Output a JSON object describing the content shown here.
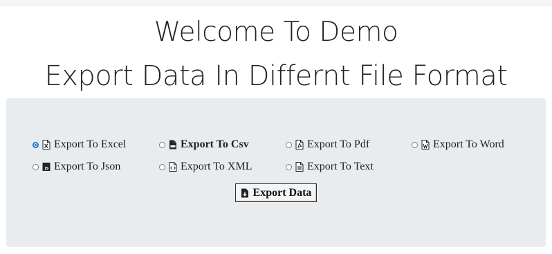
{
  "header": {
    "title_line1": "Welcome To Demo",
    "title_line2": "Export Data In Differnt File Format"
  },
  "options": [
    {
      "label": "Export To Excel",
      "checked": true,
      "icon": "file-excel-icon"
    },
    {
      "label": "Export To Csv",
      "checked": false,
      "icon": "file-csv-icon"
    },
    {
      "label": "Export To Pdf",
      "checked": false,
      "icon": "file-pdf-icon"
    },
    {
      "label": "Export To Word",
      "checked": false,
      "icon": "file-word-icon"
    },
    {
      "label": "Export To Json",
      "checked": false,
      "icon": "file-json-icon"
    },
    {
      "label": "Export To XML",
      "checked": false,
      "icon": "file-code-icon"
    },
    {
      "label": "Export To Text",
      "checked": false,
      "icon": "file-text-icon"
    }
  ],
  "export_button": {
    "label": "Export Data",
    "icon": "file-export-icon"
  },
  "colors": {
    "panel_bg": "#e9ecef",
    "radio_accent": "#1a73e8"
  }
}
